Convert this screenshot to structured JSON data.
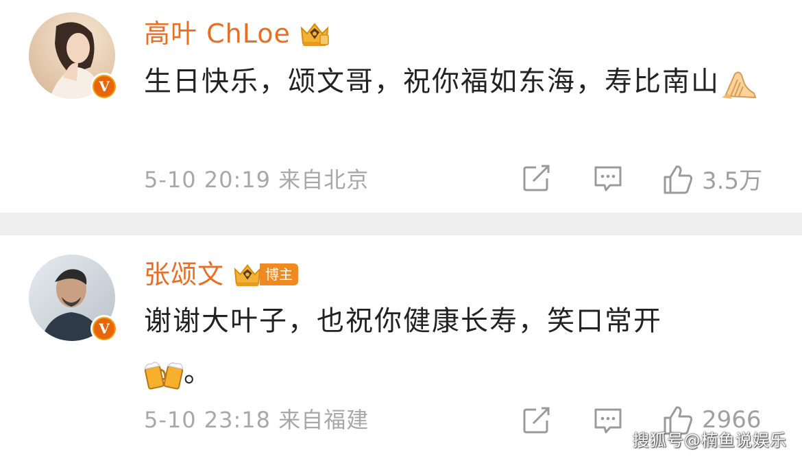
{
  "comments": [
    {
      "username": "高叶 ChLoe",
      "text": "生日快乐，颂文哥，祝你福如东海，寿比南山",
      "emoji_icon": "folded-hands-emoji",
      "date": "5-10",
      "time": "20:19",
      "location": "来自北京",
      "likes": "3.5万",
      "verified_badge": "V"
    },
    {
      "username": "张颂文",
      "tag": "博主",
      "text": "谢谢大叶子，也祝你健康长寿，笑口常开",
      "emoji_icon": "clinking-beer-mugs-emoji",
      "trailing": "。",
      "date": "5-10",
      "time": "23:18",
      "location": "来自福建",
      "likes": "2966",
      "verified_badge": "V"
    }
  ],
  "watermark": "搜狐号@楠鱼说娱乐",
  "colors": {
    "username": "#e86e25",
    "body_text": "#222222",
    "meta_text": "#a8a8a8",
    "divider": "#eeeeee",
    "badge_orange": "#f08a20"
  },
  "icons": [
    "repost-icon",
    "comment-icon",
    "like-icon",
    "crown-badge-icon",
    "verified-v-icon"
  ]
}
